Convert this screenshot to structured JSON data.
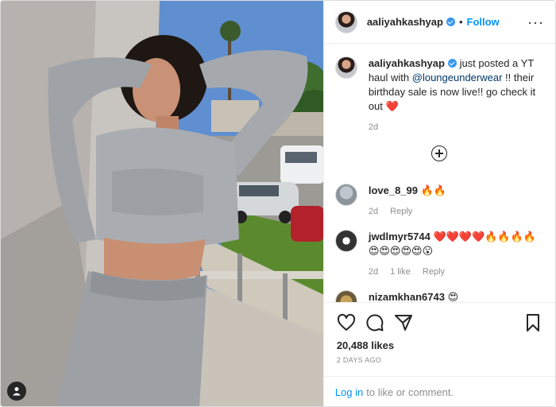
{
  "post": {
    "author": "aaliyahkashyap",
    "follow_label": "Follow",
    "separator": "•",
    "caption": {
      "username": "aaliyahkashyap",
      "text_before": " just posted a YT haul with ",
      "mention": "@loungeunderwear",
      "text_after": " !! their birthday sale is now live!! go check it out ❤️",
      "age": "2d"
    },
    "comments": [
      {
        "username": "love_8_99",
        "text": "🔥🔥",
        "age": "2d",
        "likes": "",
        "reply_label": "Reply"
      },
      {
        "username": "jwdlmyr5744",
        "text": "❤️❤️❤️❤️🔥🔥🔥🔥 😍😍😍😍😍😮",
        "age": "2d",
        "likes": "1 like",
        "reply_label": "Reply"
      },
      {
        "username": "nizamkhan6743",
        "text": "😍",
        "age": "",
        "likes": "",
        "reply_label": ""
      }
    ],
    "likes_count": "20,488 likes",
    "date": "2 DAYS AGO"
  },
  "login_bar": {
    "login_label": "Log in",
    "rest_text": "to like or comment."
  },
  "icons": [
    "more-icon",
    "plus-circle-icon",
    "heart-icon",
    "comment-icon",
    "share-icon",
    "save-icon",
    "user-tag-icon"
  ],
  "colors": {
    "accent": "#0095f6",
    "verified": "#3897f0",
    "text": "#262626",
    "muted": "#8e8e8e"
  }
}
